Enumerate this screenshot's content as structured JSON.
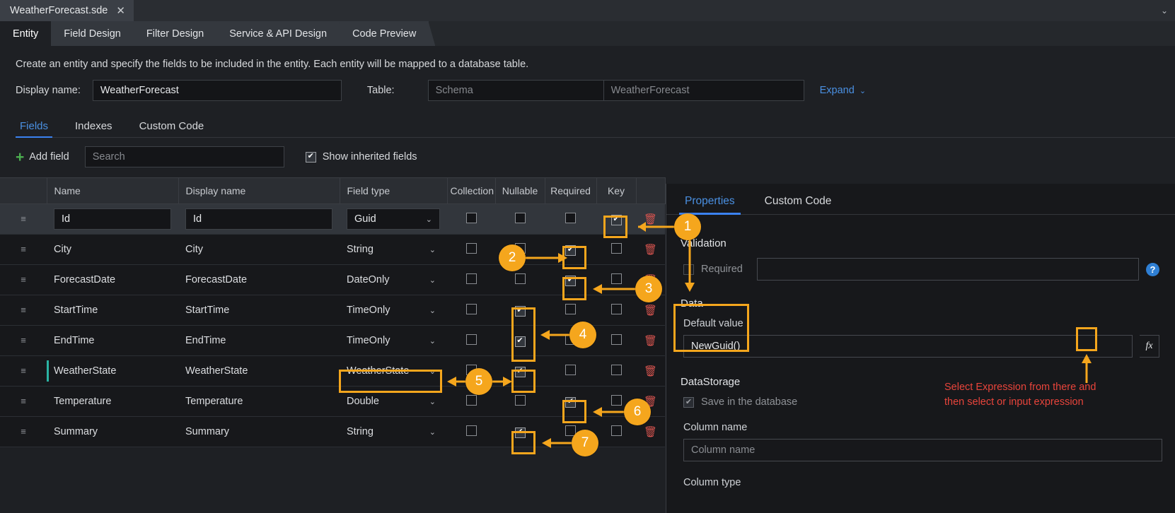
{
  "window": {
    "doc_tab": "WeatherForecast.sde",
    "close_icon": "close-icon",
    "overflow_icon": "chevron-down-icon"
  },
  "section_tabs": [
    {
      "label": "Entity",
      "active": true
    },
    {
      "label": "Field Design",
      "active": false
    },
    {
      "label": "Filter Design",
      "active": false
    },
    {
      "label": "Service & API Design",
      "active": false
    },
    {
      "label": "Code Preview",
      "active": false
    }
  ],
  "description": "Create an entity and specify the fields to be included in the entity.  Each entity will be mapped to a database table.",
  "entity": {
    "display_name_label": "Display name:",
    "display_name_value": "WeatherForecast",
    "table_label": "Table:",
    "schema_placeholder": "Schema",
    "table_placeholder": "WeatherForecast",
    "expand_label": "Expand",
    "expand_caret": "chevron-down-icon"
  },
  "sub_tabs": [
    {
      "label": "Fields",
      "active": true
    },
    {
      "label": "Indexes",
      "active": false
    },
    {
      "label": "Custom Code",
      "active": false
    }
  ],
  "toolbar": {
    "add_field_label": "Add field",
    "add_icon": "plus-icon",
    "search_placeholder": "Search",
    "search_value": "",
    "show_inherited_label": "Show inherited fields",
    "show_inherited_checked": true
  },
  "grid": {
    "columns": [
      "",
      "Name",
      "Display name",
      "Field type",
      "Collection",
      "Nullable",
      "Required",
      "Key",
      ""
    ],
    "rows": [
      {
        "name": "Id",
        "display_name": "Id",
        "field_type": "Guid",
        "collection": false,
        "nullable": false,
        "required": false,
        "key": true,
        "selected": true,
        "accent": false,
        "editable": true
      },
      {
        "name": "City",
        "display_name": "City",
        "field_type": "String",
        "collection": false,
        "nullable": false,
        "required": true,
        "key": false,
        "selected": false,
        "accent": false,
        "editable": false
      },
      {
        "name": "ForecastDate",
        "display_name": "ForecastDate",
        "field_type": "DateOnly",
        "collection": false,
        "nullable": false,
        "required": true,
        "key": false,
        "selected": false,
        "accent": false,
        "editable": false
      },
      {
        "name": "StartTime",
        "display_name": "StartTime",
        "field_type": "TimeOnly",
        "collection": false,
        "nullable": true,
        "required": false,
        "key": false,
        "selected": false,
        "accent": false,
        "editable": false
      },
      {
        "name": "EndTime",
        "display_name": "EndTime",
        "field_type": "TimeOnly",
        "collection": false,
        "nullable": true,
        "required": false,
        "key": false,
        "selected": false,
        "accent": false,
        "editable": false
      },
      {
        "name": "WeatherState",
        "display_name": "WeatherState",
        "field_type": "WeatherState",
        "collection": false,
        "nullable": true,
        "required": false,
        "key": false,
        "selected": false,
        "accent": true,
        "editable": false
      },
      {
        "name": "Temperature",
        "display_name": "Temperature",
        "field_type": "Double",
        "collection": false,
        "nullable": false,
        "required": true,
        "key": false,
        "selected": false,
        "accent": false,
        "editable": false
      },
      {
        "name": "Summary",
        "display_name": "Summary",
        "field_type": "String",
        "collection": false,
        "nullable": true,
        "required": false,
        "key": false,
        "selected": false,
        "accent": false,
        "editable": false
      }
    ],
    "handle_icon": "drag-handle-icon",
    "delete_icon": "trash-icon",
    "caret_icon": "chevron-down-icon"
  },
  "properties": {
    "tabs": [
      {
        "label": "Properties",
        "active": true
      },
      {
        "label": "Custom Code",
        "active": false
      }
    ],
    "validation_heading": "Validation",
    "required_label": "Required",
    "required_checked": false,
    "required_value": "",
    "help_icon": "help-icon",
    "data_heading": "Data",
    "default_value_label": "Default value",
    "default_value": "NewGuid()",
    "fx_label": "fx",
    "datastorage_heading": "DataStorage",
    "save_in_db_label": "Save in the database",
    "save_in_db_checked": true,
    "column_name_label": "Column name",
    "column_name_placeholder": "Column name",
    "column_name_value": "",
    "column_type_label": "Column type"
  },
  "annotations": {
    "badges": [
      "1",
      "2",
      "3",
      "4",
      "5",
      "6",
      "7"
    ],
    "note": "Select Expression from there and then select or input expression",
    "note_color": "#e8443b",
    "accent_color": "#f5a61d"
  }
}
